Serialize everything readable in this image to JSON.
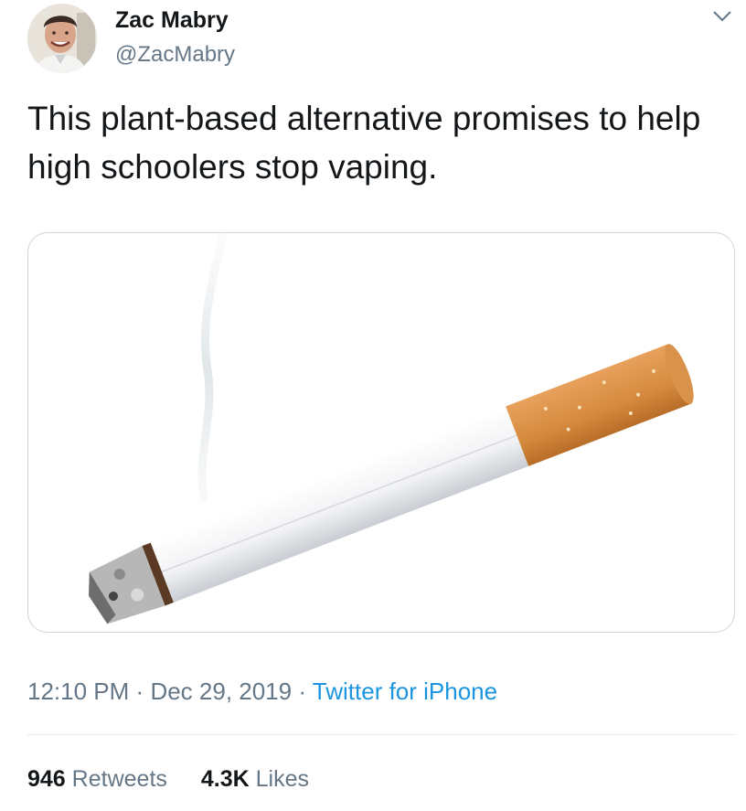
{
  "author": {
    "name": "Zac Mabry",
    "handle": "@ZacMabry"
  },
  "tweet": {
    "text": "This plant-based alternative promises to help high schoolers stop vaping."
  },
  "meta": {
    "time": "12:10 PM",
    "separator": "·",
    "date": "Dec 29, 2019",
    "source": "Twitter for iPhone"
  },
  "stats": {
    "retweets_count": "946",
    "retweets_label": "Retweets",
    "likes_count": "4.3K",
    "likes_label": "Likes"
  },
  "colors": {
    "link": "#1b95e0",
    "secondary_text": "#657786",
    "border": "#ccd6dd"
  },
  "icons": {
    "menu": "chevron-down-icon"
  }
}
